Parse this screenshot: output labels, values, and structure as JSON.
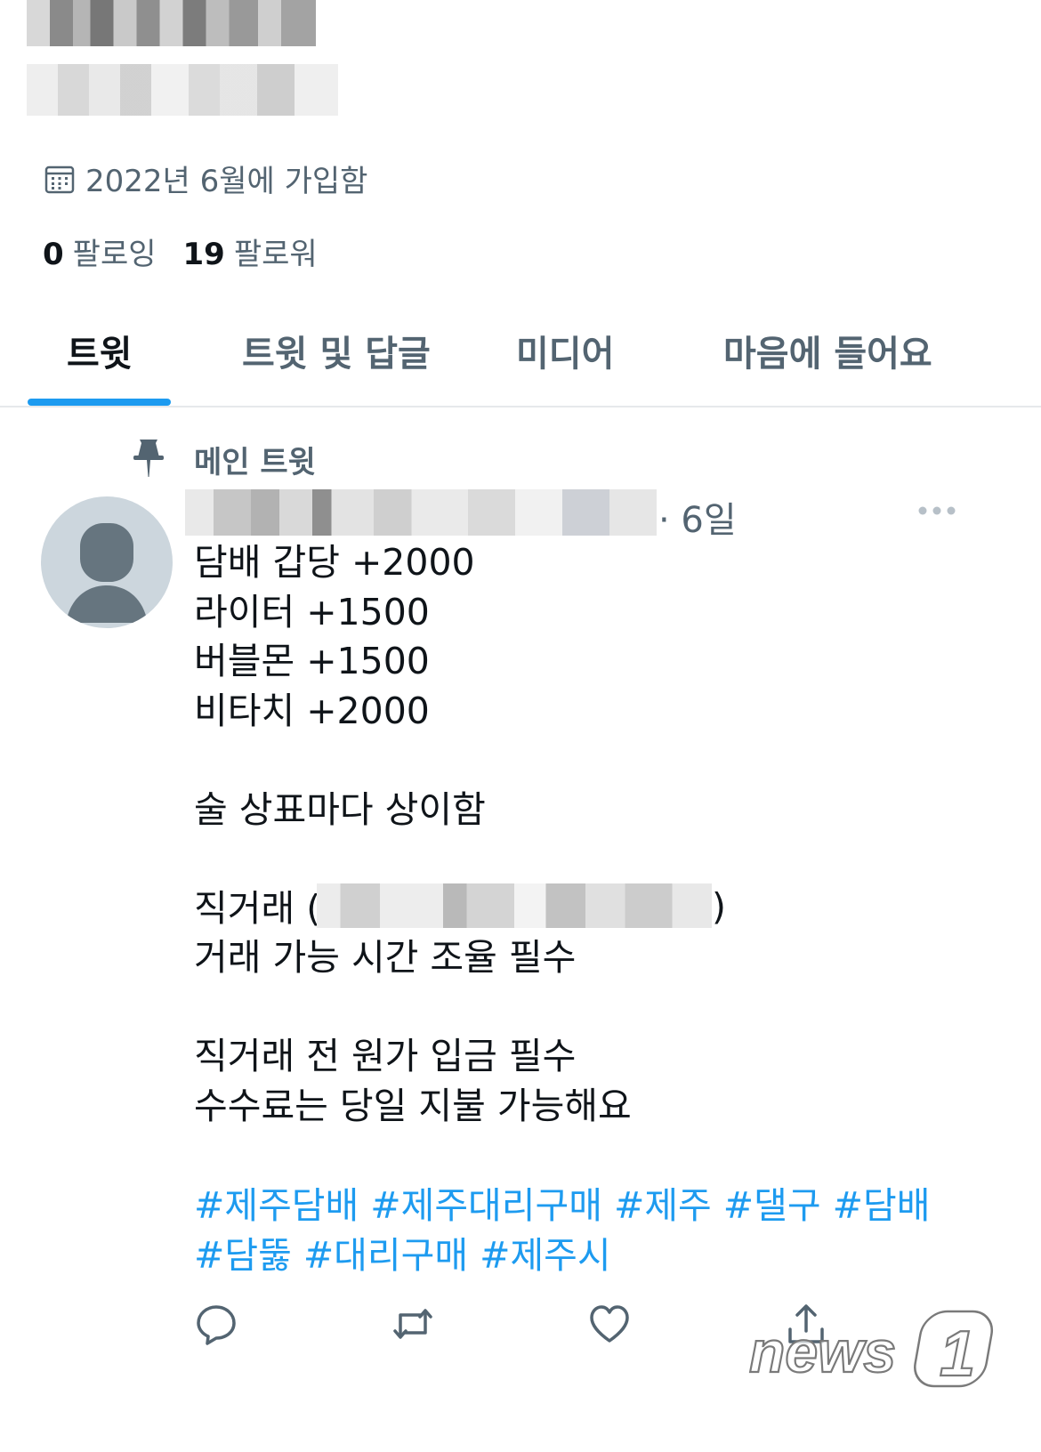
{
  "profile": {
    "joined": "2022년 6월에 가입함",
    "following_count": "0",
    "following_label": "팔로잉",
    "followers_count": "19",
    "followers_label": "팔로워"
  },
  "tabs": [
    {
      "label": "트윗",
      "active": true
    },
    {
      "label": "트윗 및 답글",
      "active": false
    },
    {
      "label": "미디어",
      "active": false
    },
    {
      "label": "마음에 들어요",
      "active": false
    }
  ],
  "tweet": {
    "pinned_label": "메인 트윗",
    "time": "· 6일",
    "lines_1": "담배 갑당 +2000\n라이터 +1500\n버블몬 +1500\n비타치 +2000\n\n술 상표마다 상이함\n\n직거래 (",
    "paren_close": ")",
    "lines_2": "거래 가능 시간 조율 필수\n\n직거래 전 원가 입금 필수\n수수료는 당일 지불 가능해요",
    "hashtags": "#제주담배 #제주대리구매 #제주 #댈구 #담배 #담뚫 #대리구매 #제주시"
  },
  "colors": {
    "accent": "#1d9bf0",
    "secondary_text": "#536471",
    "text": "#0f1419"
  },
  "icons": [
    "calendar-icon",
    "pin-icon",
    "more-icon",
    "reply-icon",
    "retweet-icon",
    "like-icon",
    "share-icon"
  ],
  "watermark": "news1"
}
